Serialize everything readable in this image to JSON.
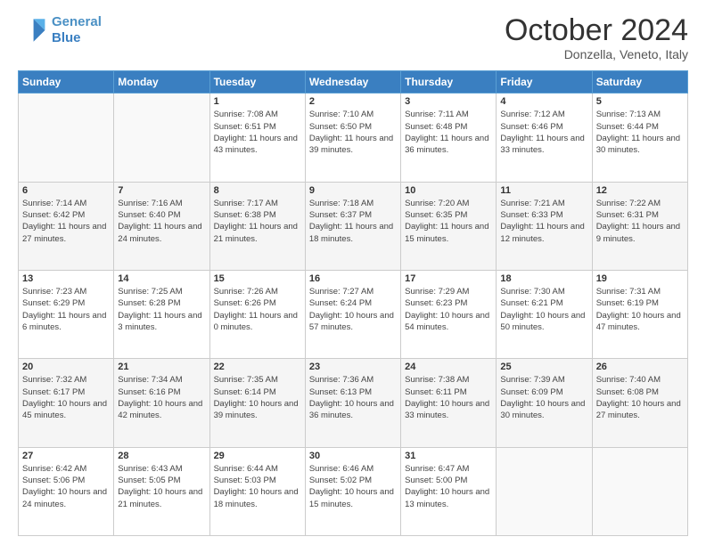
{
  "logo": {
    "line1": "General",
    "line2": "Blue"
  },
  "header": {
    "month": "October 2024",
    "location": "Donzella, Veneto, Italy"
  },
  "days_of_week": [
    "Sunday",
    "Monday",
    "Tuesday",
    "Wednesday",
    "Thursday",
    "Friday",
    "Saturday"
  ],
  "weeks": [
    [
      {
        "day": "",
        "detail": ""
      },
      {
        "day": "",
        "detail": ""
      },
      {
        "day": "1",
        "detail": "Sunrise: 7:08 AM\nSunset: 6:51 PM\nDaylight: 11 hours and 43 minutes."
      },
      {
        "day": "2",
        "detail": "Sunrise: 7:10 AM\nSunset: 6:50 PM\nDaylight: 11 hours and 39 minutes."
      },
      {
        "day": "3",
        "detail": "Sunrise: 7:11 AM\nSunset: 6:48 PM\nDaylight: 11 hours and 36 minutes."
      },
      {
        "day": "4",
        "detail": "Sunrise: 7:12 AM\nSunset: 6:46 PM\nDaylight: 11 hours and 33 minutes."
      },
      {
        "day": "5",
        "detail": "Sunrise: 7:13 AM\nSunset: 6:44 PM\nDaylight: 11 hours and 30 minutes."
      }
    ],
    [
      {
        "day": "6",
        "detail": "Sunrise: 7:14 AM\nSunset: 6:42 PM\nDaylight: 11 hours and 27 minutes."
      },
      {
        "day": "7",
        "detail": "Sunrise: 7:16 AM\nSunset: 6:40 PM\nDaylight: 11 hours and 24 minutes."
      },
      {
        "day": "8",
        "detail": "Sunrise: 7:17 AM\nSunset: 6:38 PM\nDaylight: 11 hours and 21 minutes."
      },
      {
        "day": "9",
        "detail": "Sunrise: 7:18 AM\nSunset: 6:37 PM\nDaylight: 11 hours and 18 minutes."
      },
      {
        "day": "10",
        "detail": "Sunrise: 7:20 AM\nSunset: 6:35 PM\nDaylight: 11 hours and 15 minutes."
      },
      {
        "day": "11",
        "detail": "Sunrise: 7:21 AM\nSunset: 6:33 PM\nDaylight: 11 hours and 12 minutes."
      },
      {
        "day": "12",
        "detail": "Sunrise: 7:22 AM\nSunset: 6:31 PM\nDaylight: 11 hours and 9 minutes."
      }
    ],
    [
      {
        "day": "13",
        "detail": "Sunrise: 7:23 AM\nSunset: 6:29 PM\nDaylight: 11 hours and 6 minutes."
      },
      {
        "day": "14",
        "detail": "Sunrise: 7:25 AM\nSunset: 6:28 PM\nDaylight: 11 hours and 3 minutes."
      },
      {
        "day": "15",
        "detail": "Sunrise: 7:26 AM\nSunset: 6:26 PM\nDaylight: 11 hours and 0 minutes."
      },
      {
        "day": "16",
        "detail": "Sunrise: 7:27 AM\nSunset: 6:24 PM\nDaylight: 10 hours and 57 minutes."
      },
      {
        "day": "17",
        "detail": "Sunrise: 7:29 AM\nSunset: 6:23 PM\nDaylight: 10 hours and 54 minutes."
      },
      {
        "day": "18",
        "detail": "Sunrise: 7:30 AM\nSunset: 6:21 PM\nDaylight: 10 hours and 50 minutes."
      },
      {
        "day": "19",
        "detail": "Sunrise: 7:31 AM\nSunset: 6:19 PM\nDaylight: 10 hours and 47 minutes."
      }
    ],
    [
      {
        "day": "20",
        "detail": "Sunrise: 7:32 AM\nSunset: 6:17 PM\nDaylight: 10 hours and 45 minutes."
      },
      {
        "day": "21",
        "detail": "Sunrise: 7:34 AM\nSunset: 6:16 PM\nDaylight: 10 hours and 42 minutes."
      },
      {
        "day": "22",
        "detail": "Sunrise: 7:35 AM\nSunset: 6:14 PM\nDaylight: 10 hours and 39 minutes."
      },
      {
        "day": "23",
        "detail": "Sunrise: 7:36 AM\nSunset: 6:13 PM\nDaylight: 10 hours and 36 minutes."
      },
      {
        "day": "24",
        "detail": "Sunrise: 7:38 AM\nSunset: 6:11 PM\nDaylight: 10 hours and 33 minutes."
      },
      {
        "day": "25",
        "detail": "Sunrise: 7:39 AM\nSunset: 6:09 PM\nDaylight: 10 hours and 30 minutes."
      },
      {
        "day": "26",
        "detail": "Sunrise: 7:40 AM\nSunset: 6:08 PM\nDaylight: 10 hours and 27 minutes."
      }
    ],
    [
      {
        "day": "27",
        "detail": "Sunrise: 6:42 AM\nSunset: 5:06 PM\nDaylight: 10 hours and 24 minutes."
      },
      {
        "day": "28",
        "detail": "Sunrise: 6:43 AM\nSunset: 5:05 PM\nDaylight: 10 hours and 21 minutes."
      },
      {
        "day": "29",
        "detail": "Sunrise: 6:44 AM\nSunset: 5:03 PM\nDaylight: 10 hours and 18 minutes."
      },
      {
        "day": "30",
        "detail": "Sunrise: 6:46 AM\nSunset: 5:02 PM\nDaylight: 10 hours and 15 minutes."
      },
      {
        "day": "31",
        "detail": "Sunrise: 6:47 AM\nSunset: 5:00 PM\nDaylight: 10 hours and 13 minutes."
      },
      {
        "day": "",
        "detail": ""
      },
      {
        "day": "",
        "detail": ""
      }
    ]
  ]
}
